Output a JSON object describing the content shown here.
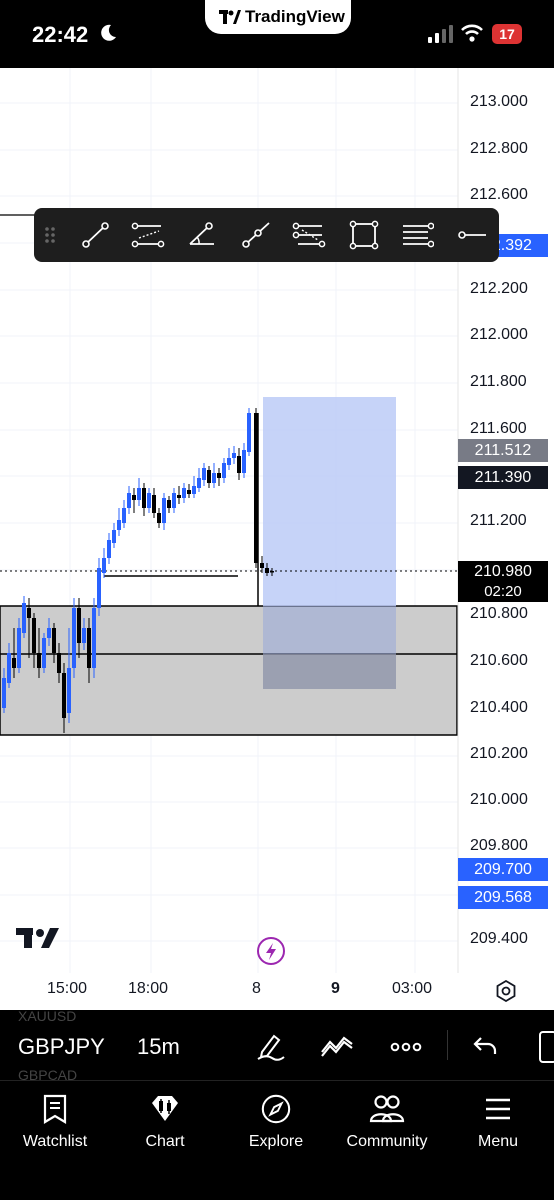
{
  "status_bar": {
    "time": "22:42",
    "brand": "TradingView",
    "battery": "17"
  },
  "chart": {
    "price_scale": [
      "213.000",
      "212.800",
      "212.600",
      "212.200",
      "212.000",
      "211.800",
      "211.600",
      "211.200",
      "210.800",
      "210.600",
      "210.400",
      "210.200",
      "210.000",
      "209.800",
      "209.400"
    ],
    "time_scale": [
      "15:00",
      "18:00",
      "8",
      "9",
      "03:00"
    ],
    "tags": {
      "hidden": "212.392",
      "high": "211.512",
      "level": "211.390",
      "last": "210.980",
      "countdown": "02:20",
      "low1": "209.700",
      "low2": "209.568"
    },
    "colors": {
      "up": "#2962ff",
      "down": "#000000",
      "zone": "#cccccc",
      "position_target": "#bccbf7",
      "position_stop": "#9aa1ae"
    }
  },
  "drawing_toolbar": {
    "tools": [
      "drag-handle-icon",
      "trend-line-icon",
      "parallel-channel-icon",
      "trend-angle-icon",
      "ray-icon",
      "regression-channel-icon",
      "rectangle-icon",
      "horizontal-lines-icon",
      "horizontal-ray-icon"
    ]
  },
  "symbol_bar": {
    "symbol": "GBPJPY",
    "interval": "15m",
    "ghost_above": "XAUUSD",
    "ghost_below": "GBPCAD"
  },
  "bottom_nav": [
    {
      "label": "Watchlist",
      "icon": "watchlist-icon"
    },
    {
      "label": "Chart",
      "icon": "chart-icon"
    },
    {
      "label": "Explore",
      "icon": "compass-icon"
    },
    {
      "label": "Community",
      "icon": "community-icon"
    },
    {
      "label": "Menu",
      "icon": "menu-icon"
    }
  ]
}
